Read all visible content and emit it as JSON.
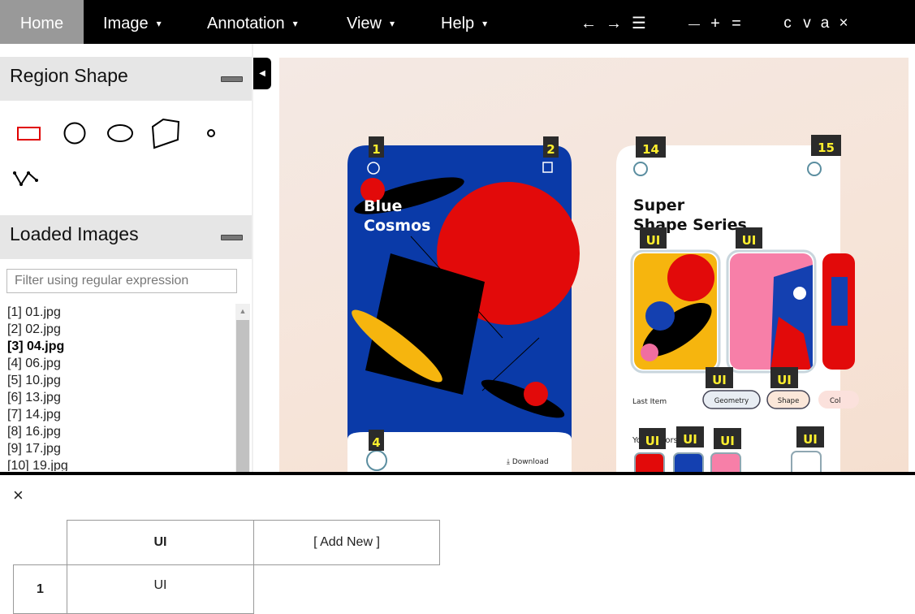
{
  "menubar": {
    "home": "Home",
    "image": "Image",
    "annotation": "Annotation",
    "view": "View",
    "help": "Help",
    "caret": "▾",
    "nav_prev": "←",
    "nav_next": "→",
    "nav_list": "☰",
    "zoom_out": "—",
    "zoom_in": "+",
    "zoom_reset": "=",
    "copy": "c",
    "paste": "v",
    "select_all": "a",
    "delete": "×"
  },
  "region_shape": {
    "title": "Region Shape",
    "active_shape": "rectangle",
    "shapes": [
      "rectangle",
      "circle",
      "ellipse",
      "polygon",
      "point",
      "polyline"
    ],
    "active_color": "#e00000"
  },
  "loaded_images": {
    "title": "Loaded Images",
    "filter_placeholder": "Filter using regular expression",
    "items": [
      {
        "index": "[1]",
        "name": "01.jpg"
      },
      {
        "index": "[2]",
        "name": "02.jpg"
      },
      {
        "index": "[3]",
        "name": "04.jpg"
      },
      {
        "index": "[4]",
        "name": "06.jpg"
      },
      {
        "index": "[5]",
        "name": "10.jpg"
      },
      {
        "index": "[6]",
        "name": "13.jpg"
      },
      {
        "index": "[7]",
        "name": "14.jpg"
      },
      {
        "index": "[8]",
        "name": "16.jpg"
      },
      {
        "index": "[9]",
        "name": "17.jpg"
      },
      {
        "index": "[10]",
        "name": "19.jpg"
      }
    ],
    "selected_index": 2
  },
  "canvas": {
    "left_card": {
      "title_line1": "Blue",
      "title_line2": "Cosmos",
      "download_label": "Download"
    },
    "right_card": {
      "title_line1": "Super",
      "title_line2": "Shape Series",
      "last_item_label": "Last Item",
      "chips": [
        "Geometry",
        "Shape",
        "Col"
      ],
      "your_colors_label": "Your Colors"
    },
    "region_labels": [
      "1",
      "2",
      "4",
      "14",
      "15",
      "UI",
      "UI",
      "UI",
      "UI",
      "UI",
      "UI",
      "UI",
      "UI",
      "UI"
    ],
    "label_bg": "#2b2b2b",
    "label_fg": "#ffef2e"
  },
  "attribute_editor": {
    "close_icon": "×",
    "column_header": "UI",
    "add_new": "[ Add New ]",
    "rows": [
      {
        "id": "1",
        "value": "UI"
      }
    ]
  }
}
